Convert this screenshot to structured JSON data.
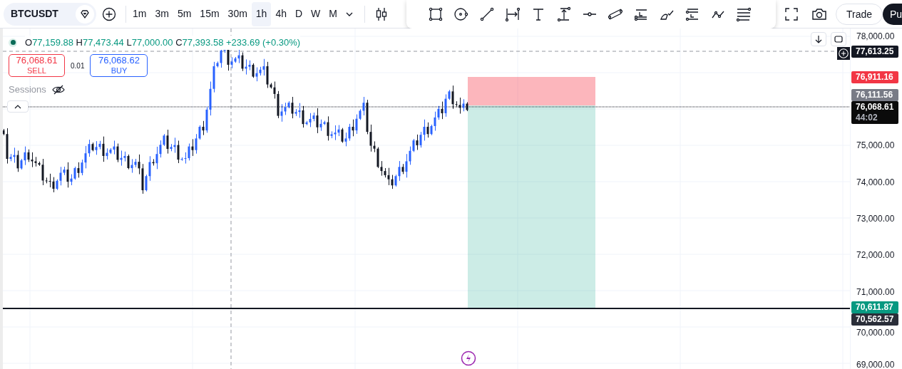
{
  "toolbar": {
    "symbol": "BTCUSDT",
    "intervals": [
      {
        "label": "1m",
        "selected": false
      },
      {
        "label": "3m",
        "selected": false
      },
      {
        "label": "5m",
        "selected": false
      },
      {
        "label": "15m",
        "selected": false
      },
      {
        "label": "30m",
        "selected": false
      },
      {
        "label": "1h",
        "selected": true
      },
      {
        "label": "4h",
        "selected": false
      },
      {
        "label": "D",
        "selected": false
      },
      {
        "label": "W",
        "selected": false
      },
      {
        "label": "M",
        "selected": false
      }
    ],
    "buttons": [
      {
        "label": "Trade",
        "kind": "outline"
      },
      {
        "label": "Pu",
        "kind": "solid"
      }
    ]
  },
  "legend": {
    "open_label": "O",
    "open": "77,159.88",
    "high_label": "H",
    "high": "77,473.44",
    "low_label": "L",
    "low": "77,000.00",
    "close_label": "C",
    "close": "77,393.58",
    "change": "+233.69 (+0.30%)"
  },
  "order": {
    "sell_price": "76,068.61",
    "sell_label": "SELL",
    "quantity": "0.01",
    "buy_price": "76,068.62",
    "buy_label": "BUY"
  },
  "sessions": {
    "label": "Sessions",
    "visible": false
  },
  "price_axis": {
    "ticks": [
      "78,000.00",
      "75,000.00",
      "74,000.00",
      "73,000.00",
      "72,000.00",
      "71,000.00",
      "70,000.00",
      "69,000.00"
    ],
    "tags": [
      {
        "price": "77,613.25",
        "color": "#131722"
      },
      {
        "price": "76,911.16",
        "color": "#f23645"
      },
      {
        "price": "76,111.56",
        "color": "#787b86"
      },
      {
        "price": "76,068.61",
        "countdown": "44:02",
        "color": "#0b0b0b"
      },
      {
        "price": "70,611.87",
        "color": "#089981"
      },
      {
        "price": "70,562.57",
        "color": "#2a2e39"
      }
    ]
  }
}
